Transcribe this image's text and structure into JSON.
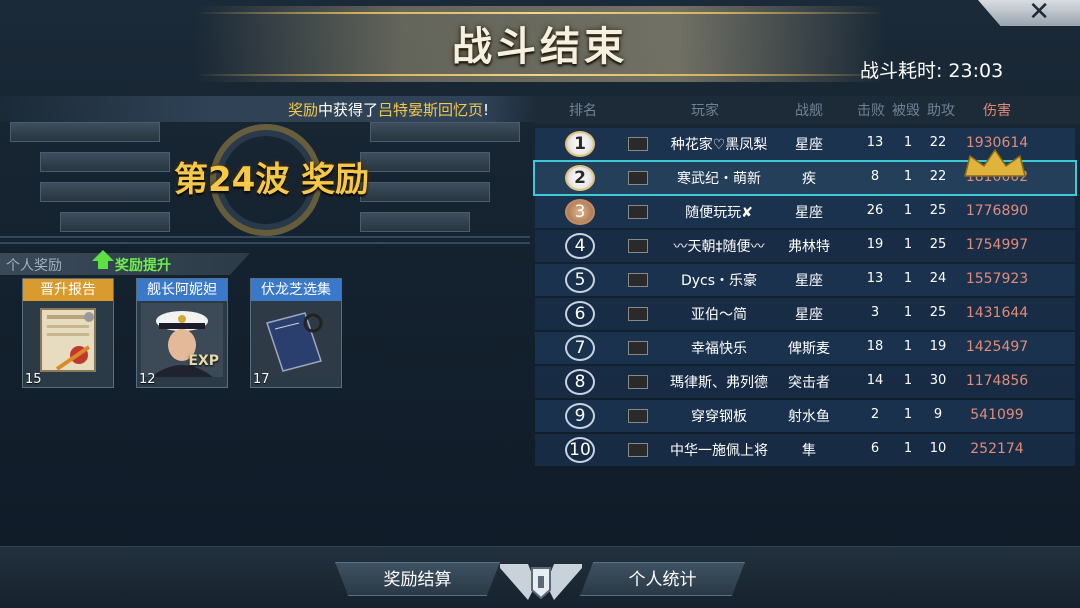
{
  "header": {
    "title": "战斗结束",
    "timer_label": "战斗耗时:",
    "timer_value": "23:03"
  },
  "notice": {
    "prefix": "奖励",
    "middle": "中获得了",
    "highlight": "吕特晏斯回忆页",
    "suffix": "!"
  },
  "wave_reward": {
    "title": "第24波 奖励"
  },
  "personal": {
    "label": "个人奖励",
    "boost": "奖励提升",
    "cards": [
      {
        "title": "晋升报告",
        "count": "15",
        "icon": "certificate-icon",
        "header_color": "#d99a2e"
      },
      {
        "title": "舰长阿妮妲",
        "count": "12",
        "icon": "captain-portrait",
        "header_color": "#3a78c9",
        "badge": "EXP"
      },
      {
        "title": "伏龙芝选集",
        "count": "17",
        "icon": "book-icon",
        "header_color": "#3a78c9"
      }
    ]
  },
  "table": {
    "headers": {
      "rank": "排名",
      "player": "玩家",
      "ship": "战舰",
      "kills": "击败",
      "destroyed": "被毁",
      "assists": "助攻",
      "damage": "伤害"
    },
    "rows": [
      {
        "rank": "1",
        "name": "种花家♡黑凤梨",
        "ship": "星座",
        "kills": "13",
        "destroyed": "1",
        "assists": "22",
        "damage": "1930614"
      },
      {
        "rank": "2",
        "name": "寒武纪・萌新",
        "ship": "疾",
        "kills": "8",
        "destroyed": "1",
        "assists": "22",
        "damage": "1810002"
      },
      {
        "rank": "3",
        "name": "随便玩玩✘",
        "ship": "星座",
        "kills": "26",
        "destroyed": "1",
        "assists": "25",
        "damage": "1776890"
      },
      {
        "rank": "4",
        "name": "〰天朝‡随便〰",
        "ship": "弗林特",
        "kills": "19",
        "destroyed": "1",
        "assists": "25",
        "damage": "1754997"
      },
      {
        "rank": "5",
        "name": "Dycs・乐豪",
        "ship": "星座",
        "kills": "13",
        "destroyed": "1",
        "assists": "24",
        "damage": "1557923"
      },
      {
        "rank": "6",
        "name": "亚伯〜简",
        "ship": "星座",
        "kills": "3",
        "destroyed": "1",
        "assists": "25",
        "damage": "1431644"
      },
      {
        "rank": "7",
        "name": "幸福快乐",
        "ship": "俾斯麦",
        "kills": "18",
        "destroyed": "1",
        "assists": "19",
        "damage": "1425497"
      },
      {
        "rank": "8",
        "name": "瑪律斯、弗列德",
        "ship": "突击者",
        "kills": "14",
        "destroyed": "1",
        "assists": "30",
        "damage": "1174856"
      },
      {
        "rank": "9",
        "name": "穿穿钢板",
        "ship": "射水鱼",
        "kills": "2",
        "destroyed": "1",
        "assists": "9",
        "damage": "541099"
      },
      {
        "rank": "10",
        "name": "中华一施佩上将",
        "ship": "隼",
        "kills": "6",
        "destroyed": "1",
        "assists": "10",
        "damage": "252174"
      }
    ]
  },
  "buttons": {
    "settle": "奖励结算",
    "stats": "个人统计"
  },
  "colors": {
    "gold": "#f2c94c",
    "damage": "#e08c7a",
    "highlight_row": "#3dc9d8",
    "boost": "#6ef04c"
  }
}
